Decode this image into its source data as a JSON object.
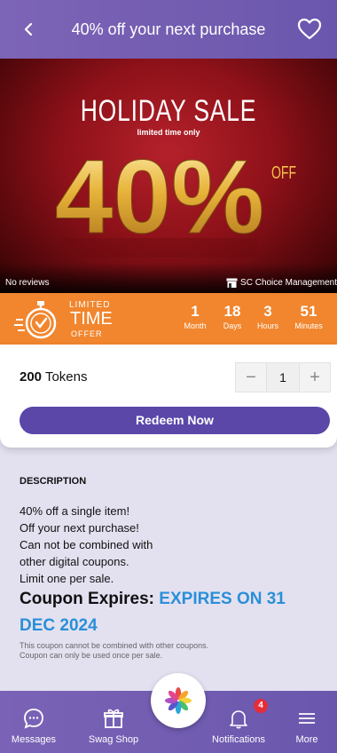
{
  "header": {
    "title": "40% off your next purchase",
    "back_icon": "chevron-left-icon",
    "favorite_icon": "heart-outline-icon"
  },
  "banner": {
    "headline": "HOLIDAY SALE",
    "subline": "limited time only",
    "percent": "40%",
    "off": "OFF",
    "reviews": "No reviews",
    "vendor": "SC Choice Management"
  },
  "offer": {
    "limited": "LIMITED",
    "time": "TIME",
    "offer": "OFFER",
    "countdown": [
      {
        "value": "1",
        "label": "Month"
      },
      {
        "value": "18",
        "label": "Days"
      },
      {
        "value": "3",
        "label": "Hours"
      },
      {
        "value": "51",
        "label": "Minutes"
      }
    ]
  },
  "purchase": {
    "tokens_amount": "200",
    "tokens_label": "Tokens",
    "minus": "−",
    "quantity": "1",
    "plus": "+",
    "redeem_label": "Redeem Now"
  },
  "description": {
    "heading": "DESCRIPTION",
    "lines": [
      "40% off a single item!",
      "Off your next purchase!",
      "Can not be combined with",
      "other digital coupons.",
      "Limit one per sale."
    ],
    "expires_label": "Coupon Expires:",
    "expires_value": "EXPIRES ON 31 DEC 2024",
    "note_lines": [
      "This coupon cannot be combined with other coupons.",
      "Coupon can only be used once per sale."
    ]
  },
  "nav": {
    "items": [
      {
        "label": "Messages",
        "icon": "chat-bubble-icon"
      },
      {
        "label": "Swag Shop",
        "icon": "gift-icon"
      },
      {
        "label": "Notifications",
        "icon": "bell-icon",
        "badge": "4"
      },
      {
        "label": "More",
        "icon": "menu-icon"
      }
    ],
    "center_icon": "pinwheel-logo-icon"
  },
  "colors": {
    "header": "#6f5bb0",
    "offer": "#f1862e",
    "redeem": "#5a47a8",
    "expires": "#2a8fd8",
    "badge": "#e52d3a"
  }
}
